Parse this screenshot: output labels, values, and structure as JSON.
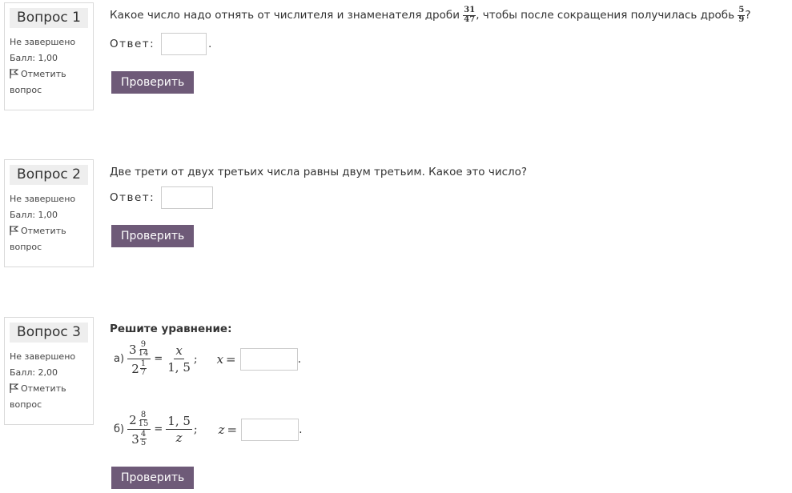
{
  "questions": [
    {
      "number": "Вопрос 1",
      "status": "Не завершено",
      "score": "Балл: 1,00",
      "flag_label": "Отметить вопрос",
      "text_before": "Какое число надо отнять от числителя и знаменателя дроби",
      "fraction1": {
        "num": "31",
        "den": "47"
      },
      "text_middle": ", чтобы после сокращения получилась дробь",
      "fraction2": {
        "num": "5",
        "den": "9"
      },
      "text_after": "?",
      "answer_label": "Ответ:",
      "answer_value": "",
      "button": "Проверить"
    },
    {
      "number": "Вопрос 2",
      "status": "Не завершено",
      "score": "Балл: 1,00",
      "flag_label": "Отметить вопрос",
      "text": "Две трети от двух третьих числа равны двум третьим. Какое это число?",
      "answer_label": "Ответ:",
      "answer_value": "",
      "button": "Проверить"
    },
    {
      "number": "Вопрос 3",
      "status": "Не завершено",
      "score": "Балл: 2,00",
      "flag_label": "Отметить вопрос",
      "heading": "Решите уравнение:",
      "eq_a": {
        "label": "а)",
        "top_whole": "3",
        "top_num": "9",
        "top_den": "14",
        "bottom_whole": "2",
        "bottom_num": "1",
        "bottom_den": "7",
        "rhs_num": "x",
        "rhs_den": "1, 5",
        "var": "x",
        "answer_value": ""
      },
      "eq_b": {
        "label": "б)",
        "top_whole": "2",
        "top_num": "8",
        "top_den": "15",
        "bottom_whole": "3",
        "bottom_num": "4",
        "bottom_den": "5",
        "rhs_num": "1, 5",
        "rhs_den": "z",
        "var": "z",
        "answer_value": ""
      },
      "button": "Проверить"
    }
  ]
}
